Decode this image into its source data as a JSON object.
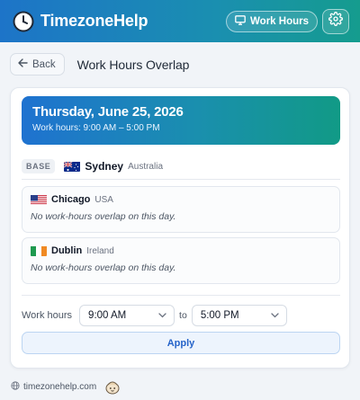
{
  "header": {
    "brand": "TimezoneHelp",
    "work_hours_label": "Work Hours",
    "icons": {
      "logo": "clock-icon",
      "work_hours": "monitor-icon",
      "settings": "gear-icon"
    }
  },
  "nav": {
    "back_label": "Back",
    "page_title": "Work Hours Overlap"
  },
  "date_banner": {
    "date": "Thursday, June 25, 2026",
    "work_hours_text": "Work hours: 9:00 AM – 5:00 PM"
  },
  "base": {
    "badge": "BASE",
    "flag": "australia-flag",
    "city": "Sydney",
    "country": "Australia"
  },
  "cities": [
    {
      "flag": "usa-flag",
      "city": "Chicago",
      "country": "USA",
      "note": "No work-hours overlap on this day."
    },
    {
      "flag": "ireland-flag",
      "city": "Dublin",
      "country": "Ireland",
      "note": "No work-hours overlap on this day."
    }
  ],
  "work_hours": {
    "label": "Work hours",
    "start": "9:00 AM",
    "to_label": "to",
    "end": "5:00 PM",
    "apply_label": "Apply"
  },
  "footer": {
    "site": "timezonehelp.com",
    "icons": {
      "globe": "globe-icon",
      "mascot": "mascot-icon"
    }
  },
  "colors": {
    "header_gradient": [
      "#1d74c8",
      "#159c8e"
    ],
    "accent": "#2563c9",
    "page_bg": "#f1f4f8"
  }
}
